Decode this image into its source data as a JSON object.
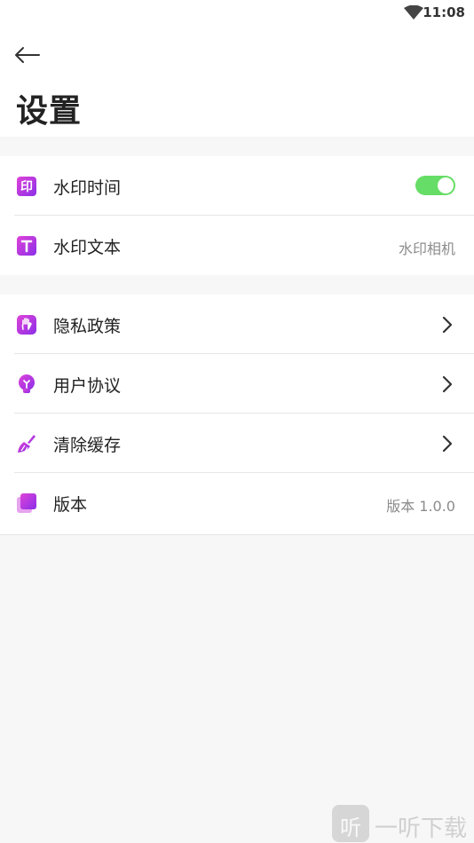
{
  "status_bar": {
    "time": "11:08",
    "wifi_icon": "wifi-icon"
  },
  "header": {
    "back_icon": "arrow-left-icon",
    "title": "设置"
  },
  "groups": [
    {
      "items": [
        {
          "icon": "印",
          "icon_name": "watermark-seal-icon",
          "label": "水印时间",
          "control": "toggle",
          "toggle_on": true,
          "toggle_color": "#66dd66"
        },
        {
          "icon": "T",
          "icon_name": "text-icon",
          "label": "水印文本",
          "value": "水印相机"
        }
      ]
    },
    {
      "items": [
        {
          "icon_name": "hand-icon",
          "label": "隐私政策",
          "chevron": true
        },
        {
          "icon_name": "bulb-icon",
          "label": "用户协议",
          "chevron": true
        },
        {
          "icon_name": "broom-icon",
          "label": "清除缓存",
          "chevron": true
        },
        {
          "icon_name": "layers-icon",
          "label": "版本",
          "value": "版本 1.0.0"
        }
      ]
    }
  ],
  "watermark": {
    "logo_text": "听",
    "text": "一听下载"
  },
  "colors": {
    "accent_gradient_start": "#d43fe0",
    "accent_gradient_end": "#8a2be2",
    "toggle_on": "#66dd66"
  }
}
